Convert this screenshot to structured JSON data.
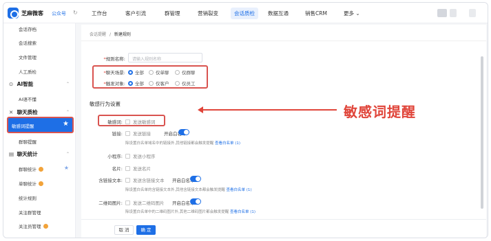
{
  "topbar": {
    "brand": "芝麻微客",
    "account": "公众号",
    "tabs": [
      "工作台",
      "客户引流",
      "群管理",
      "营销裂变",
      "会话质检",
      "数据互通",
      "销售CRM",
      "更多 ⌄"
    ],
    "active_tab_index": 4
  },
  "sidebar": {
    "items_top": [
      "会话存档",
      "会话搜索",
      "文件管理",
      "人工质检"
    ],
    "group_ai": "AI智能",
    "ai_items": [
      "AI语不懂"
    ],
    "group_chatcheck": "聊天质检",
    "active_item": "敏感词提醒",
    "chatcheck_items": [
      "群聊提醒"
    ],
    "group_stats": "聊天统计",
    "stats_items": [
      "群聊统计",
      "单聊统计",
      "统计规则",
      "关注群管理",
      "关注员管理"
    ]
  },
  "content": {
    "breadcrumb_parent": "会话提醒",
    "breadcrumb_sep": "/",
    "breadcrumb_current": "新建规则",
    "rule_name_label": "规则名称:",
    "rule_name_placeholder": "请输入规则名称",
    "scene_label": "聊天场景:",
    "scene_options": [
      "全部",
      "仅单聊",
      "仅群聊"
    ],
    "target_label": "触发对象:",
    "target_options": [
      "全部",
      "仅客户",
      "仅员工"
    ],
    "section_title": "敏感行为设置",
    "sensitive_label": "敏感词:",
    "sensitive_check": "发送敏感词",
    "link_label": "链接:",
    "link_check": "发送链接",
    "whitelist_label": "开启白名单",
    "link_hint": "除设置白名单域名中的链接外,其他链接都会触发提醒",
    "view_whitelist": "查看白名单",
    "whitelist_count": "(1)",
    "miniapp_label": "小程序:",
    "miniapp_check": "发送小程序",
    "card_label": "名片:",
    "card_check": "发送名片",
    "phone_label": "含链接文本:",
    "phone_check": "发送含链接文本",
    "phone_hint": "除设置白名单的含链接文本外,其他含链接文本都会触发提醒",
    "qr_label": "二维码图片:",
    "qr_check": "发送二维码图片",
    "qr_hint": "除设置白名单中的二维码图片外,其他二维码图片都会触发提醒",
    "cancel": "取 消",
    "confirm": "确 定"
  },
  "annotation": {
    "callout": "敏感词提醒",
    "color": "#e0453a"
  }
}
